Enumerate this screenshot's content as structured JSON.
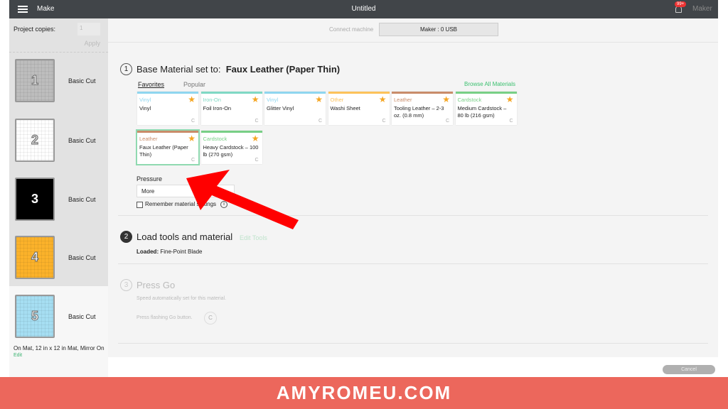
{
  "header": {
    "menu_label": "Make",
    "title": "Untitled",
    "notification_count": "99+",
    "user": "Maker"
  },
  "sidebar": {
    "copies_label": "Project copies:",
    "copies_value": "1",
    "apply": "Apply",
    "mats": [
      {
        "number": "1",
        "label": "Basic Cut",
        "color": "#bdbdbd"
      },
      {
        "number": "2",
        "label": "Basic Cut",
        "color": "#ffffff"
      },
      {
        "number": "3",
        "label": "Basic Cut",
        "color": "#000000"
      },
      {
        "number": "4",
        "label": "Basic Cut",
        "color": "#fbb22a"
      },
      {
        "number": "5",
        "label": "Basic Cut",
        "color": "#a6def2"
      }
    ],
    "selected_info": "On Mat, 12 in x 12 in Mat, Mirror On",
    "edit": "Edit"
  },
  "main": {
    "connect_label": "Connect machine",
    "machine": "Maker : 0 USB",
    "step1": {
      "number": "1",
      "prefix": "Base Material set to:",
      "material": "Faux Leather (Paper Thin)",
      "tabs": [
        "Favorites",
        "Popular"
      ],
      "browse": "Browse All Materials",
      "cards": [
        {
          "category": "Vinyl",
          "name": "Vinyl",
          "color": "#8fd6ef"
        },
        {
          "category": "Iron-On",
          "name": "Foil Iron-On",
          "color": "#7fd8c4"
        },
        {
          "category": "Vinyl",
          "name": "Glitter Vinyl",
          "color": "#8fd6ef"
        },
        {
          "category": "Other",
          "name": "Washi Sheet",
          "color": "#fcc25a"
        },
        {
          "category": "Leather",
          "name": "Tooling Leather – 2-3 oz. (0.8 mm)",
          "color": "#c98c6a"
        },
        {
          "category": "Cardstock",
          "name": "Medium Cardstock – 80 lb (216 gsm)",
          "color": "#78cf86"
        },
        {
          "category": "Leather",
          "name": "Faux Leather (Paper Thin)",
          "color": "#c98c6a"
        },
        {
          "category": "Cardstock",
          "name": "Heavy Cardstock – 100 lb (270 gsm)",
          "color": "#78cf86"
        }
      ],
      "pressure_label": "Pressure",
      "pressure_value": "More",
      "remember": "Remember material settings",
      "info": "i"
    },
    "step2": {
      "number": "2",
      "title": "Load tools and material",
      "edit_tools": "Edit Tools",
      "loaded_label": "Loaded:",
      "loaded_value": "Fine-Point Blade"
    },
    "step3": {
      "number": "3",
      "title": "Press Go",
      "speed": "Speed automatically set for this material.",
      "press": "Press flashing Go button."
    },
    "cancel": "Cancel"
  },
  "banner": "AMYROMEU.COM",
  "colors": {
    "header": "#414549",
    "accent": "#3cc070",
    "banner": "#ec675c",
    "arrow": "#ff0000"
  }
}
